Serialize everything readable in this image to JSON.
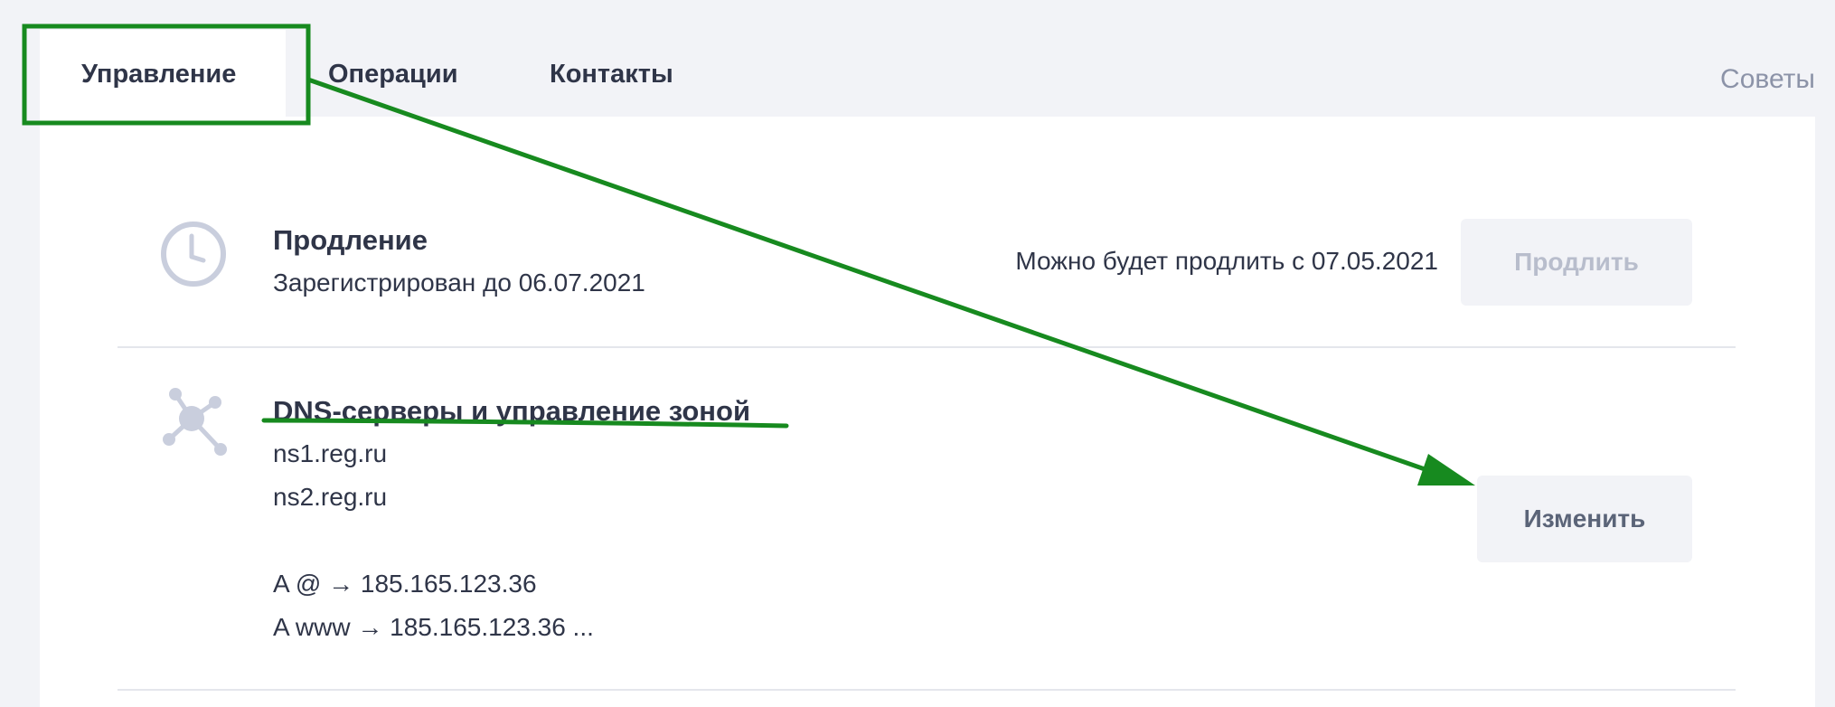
{
  "tabs": [
    {
      "label": "Управление",
      "active": true
    },
    {
      "label": "Операции",
      "active": false
    },
    {
      "label": "Контакты",
      "active": false
    }
  ],
  "tips_label": "Советы",
  "renewal": {
    "icon": "clock-icon",
    "title": "Продление",
    "registered_until": "Зарегистрирован до 06.07.2021",
    "renew_note": "Можно будет продлить с 07.05.2021",
    "button_label": "Продлить",
    "button_enabled": false
  },
  "dns": {
    "icon": "network-nodes-icon",
    "title": "DNS-серверы и управление зоной",
    "servers": [
      "ns1.reg.ru",
      "ns2.reg.ru"
    ],
    "records": [
      "A @ → 185.165.123.36",
      "A www → 185.165.123.36 ..."
    ],
    "button_label": "Изменить"
  },
  "colors": {
    "page_background": "#f2f3f7",
    "text": "#2f3548",
    "muted_text": "#8c93a8",
    "icon": "#c9cedd",
    "annotation": "#178a1f"
  }
}
